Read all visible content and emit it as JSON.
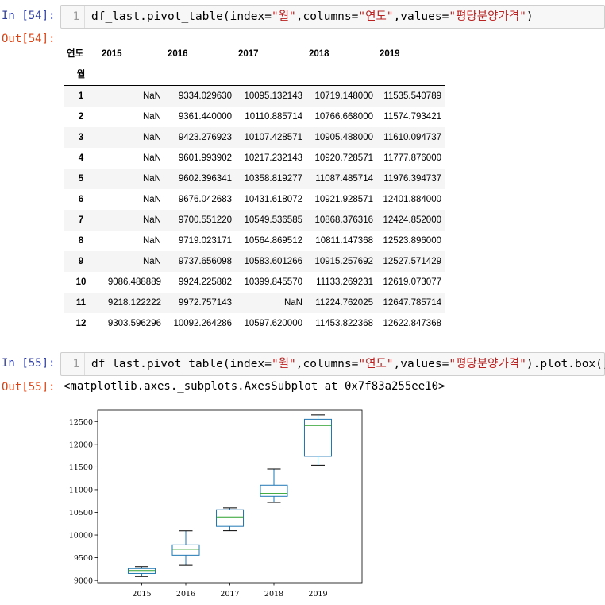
{
  "cells": [
    {
      "in_prompt": "In [54]:",
      "out_prompt": "Out[54]:",
      "line_number": "1",
      "code": {
        "func": "df_last.pivot_table(index=",
        "idx": "\"월\"",
        "mid1": ",columns=",
        "col": "\"연도\"",
        "mid2": ",values=",
        "val": "\"평당분양가격\"",
        "end": ")"
      }
    },
    {
      "in_prompt": "In [55]:",
      "out_prompt": "Out[55]:",
      "line_number": "1",
      "code": {
        "func": "df_last.pivot_table(index=",
        "idx": "\"월\"",
        "mid1": ",columns=",
        "col": "\"연도\"",
        "mid2": ",values=",
        "val": "\"평당분양가격\"",
        "end": ").plot.box()"
      },
      "output_text": "<matplotlib.axes._subplots.AxesSubplot at 0x7f83a255ee10>"
    }
  ],
  "table": {
    "columns_name": "연도",
    "index_name": "월",
    "columns": [
      "2015",
      "2016",
      "2017",
      "2018",
      "2019"
    ],
    "rows": [
      {
        "index": "1",
        "values": [
          "NaN",
          "9334.029630",
          "10095.132143",
          "10719.148000",
          "11535.540789"
        ]
      },
      {
        "index": "2",
        "values": [
          "NaN",
          "9361.440000",
          "10110.885714",
          "10766.668000",
          "11574.793421"
        ]
      },
      {
        "index": "3",
        "values": [
          "NaN",
          "9423.276923",
          "10107.428571",
          "10905.488000",
          "11610.094737"
        ]
      },
      {
        "index": "4",
        "values": [
          "NaN",
          "9601.993902",
          "10217.232143",
          "10920.728571",
          "11777.876000"
        ]
      },
      {
        "index": "5",
        "values": [
          "NaN",
          "9602.396341",
          "10358.819277",
          "11087.485714",
          "11976.394737"
        ]
      },
      {
        "index": "6",
        "values": [
          "NaN",
          "9676.042683",
          "10431.618072",
          "10921.928571",
          "12401.884000"
        ]
      },
      {
        "index": "7",
        "values": [
          "NaN",
          "9700.551220",
          "10549.536585",
          "10868.376316",
          "12424.852000"
        ]
      },
      {
        "index": "8",
        "values": [
          "NaN",
          "9719.023171",
          "10564.869512",
          "10811.147368",
          "12523.896000"
        ]
      },
      {
        "index": "9",
        "values": [
          "NaN",
          "9737.656098",
          "10583.601266",
          "10915.257692",
          "12527.571429"
        ]
      },
      {
        "index": "10",
        "values": [
          "9086.488889",
          "9924.225882",
          "10399.845570",
          "11133.269231",
          "12619.073077"
        ]
      },
      {
        "index": "11",
        "values": [
          "9218.122222",
          "9972.757143",
          "NaN",
          "11224.762025",
          "12647.785714"
        ]
      },
      {
        "index": "12",
        "values": [
          "9303.596296",
          "10092.264286",
          "10597.620000",
          "11453.822368",
          "12622.847368"
        ]
      }
    ]
  },
  "chart_data": {
    "type": "box",
    "categories": [
      "2015",
      "2016",
      "2017",
      "2018",
      "2019"
    ],
    "ylim": [
      8950,
      12750
    ],
    "yticks": [
      9000,
      9500,
      10000,
      10500,
      11000,
      11500,
      12000,
      12500
    ],
    "box_color": "#1f77b4",
    "median_color": "#2ca02c",
    "boxes": [
      {
        "whisker_low": 9086.49,
        "q1": 9152.31,
        "median": 9218.12,
        "q3": 9260.86,
        "whisker_high": 9303.6
      },
      {
        "whisker_low": 9334.03,
        "q1": 9556.81,
        "median": 9688.3,
        "q3": 9784.8,
        "whisker_high": 10092.26
      },
      {
        "whisker_low": 10095.13,
        "q1": 10190.1,
        "median": 10399.85,
        "q3": 10557.2,
        "whisker_high": 10597.62
      },
      {
        "whisker_low": 10719.15,
        "q1": 10853.62,
        "median": 10918.0,
        "q3": 11098.93,
        "whisker_high": 11453.82
      },
      {
        "whisker_low": 11535.54,
        "q1": 11735.93,
        "median": 12413.37,
        "q3": 12550.65,
        "whisker_high": 12647.79
      }
    ]
  }
}
